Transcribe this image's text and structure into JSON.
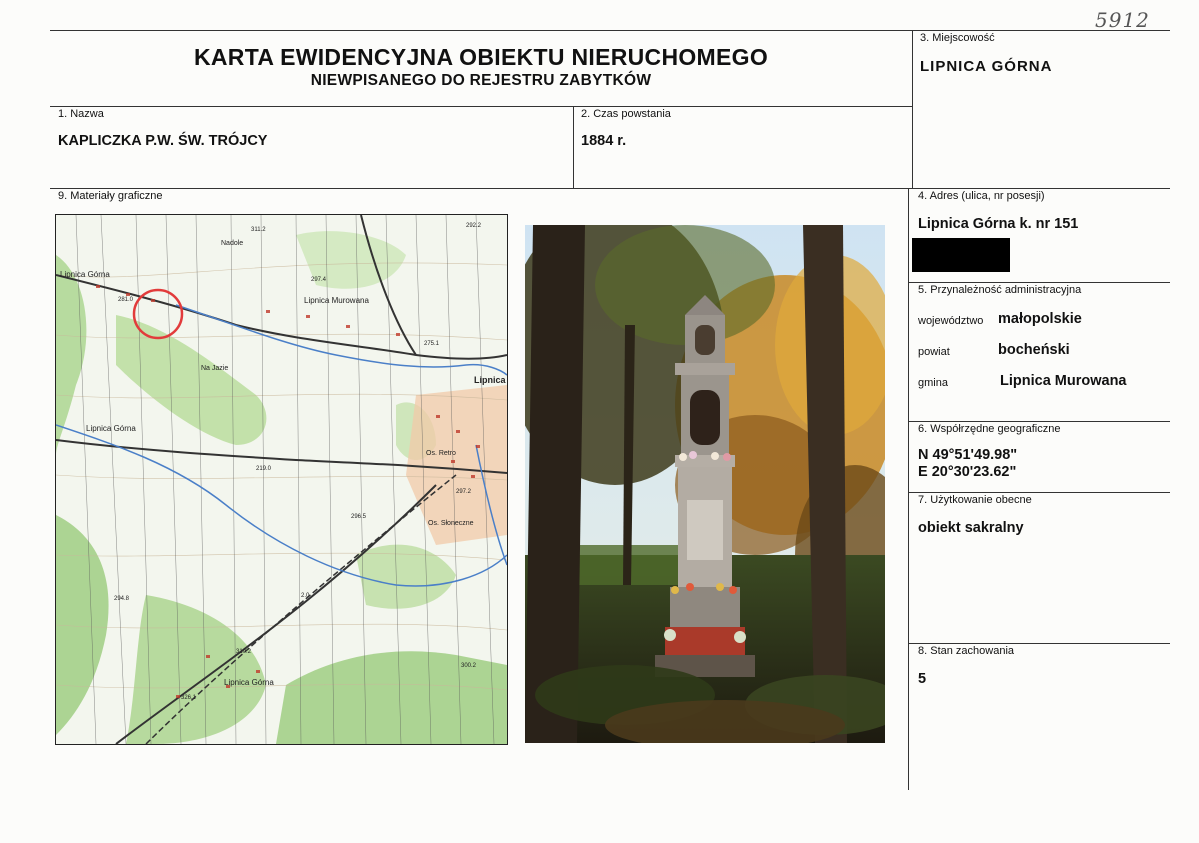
{
  "handwritten_number": "5912",
  "header": {
    "title": "KARTA EWIDENCYJNA OBIEKTU NIERUCHOMEGO",
    "subtitle": "NIEWPISANEGO DO REJESTRU ZABYTKÓW"
  },
  "field1": {
    "label": "1. Nazwa",
    "value": "KAPLICZKA P.W. ŚW. TRÓJCY"
  },
  "field2": {
    "label": "2. Czas powstania",
    "value": "1884 r."
  },
  "field3": {
    "label": "3. Miejscowość",
    "value": "LIPNICA GÓRNA"
  },
  "field4": {
    "label": "4. Adres (ulica, nr posesji)",
    "value": "Lipnica Górna k. nr 151"
  },
  "field5": {
    "label": "5. Przynależność administracyjna",
    "rows": [
      {
        "key": "województwo",
        "value": "małopolskie"
      },
      {
        "key": "powiat",
        "value": "bocheński"
      },
      {
        "key": "gmina",
        "value": "Lipnica Murowana"
      }
    ]
  },
  "field6": {
    "label": "6. Współrzędne geograficzne",
    "lat": "N 49°51'49.98\"",
    "lon": "E  20°30'23.62\""
  },
  "field7": {
    "label": "7. Użytkowanie obecne",
    "value": "obiekt sakralny"
  },
  "field8": {
    "label": "8. Stan zachowania",
    "value": "5"
  },
  "field9": {
    "label": "9. Materiały graficzne"
  },
  "map": {
    "labels": [
      "Nadole",
      "Lipnica Górna",
      "Lipnica Murowana",
      "Na Jazie",
      "Lipnica",
      "Lipnica Górna",
      "Os. Retro",
      "Os. Słoneczne",
      "Lipnica Górna"
    ],
    "heights": [
      "311.2",
      "292.2",
      "297.4",
      "281.0",
      "275.1",
      "219.0",
      "297.2",
      "296.5",
      "294.8",
      "2.0",
      "310.2",
      "300.2",
      "326.1"
    ],
    "marker_color": "#e23b3b"
  }
}
